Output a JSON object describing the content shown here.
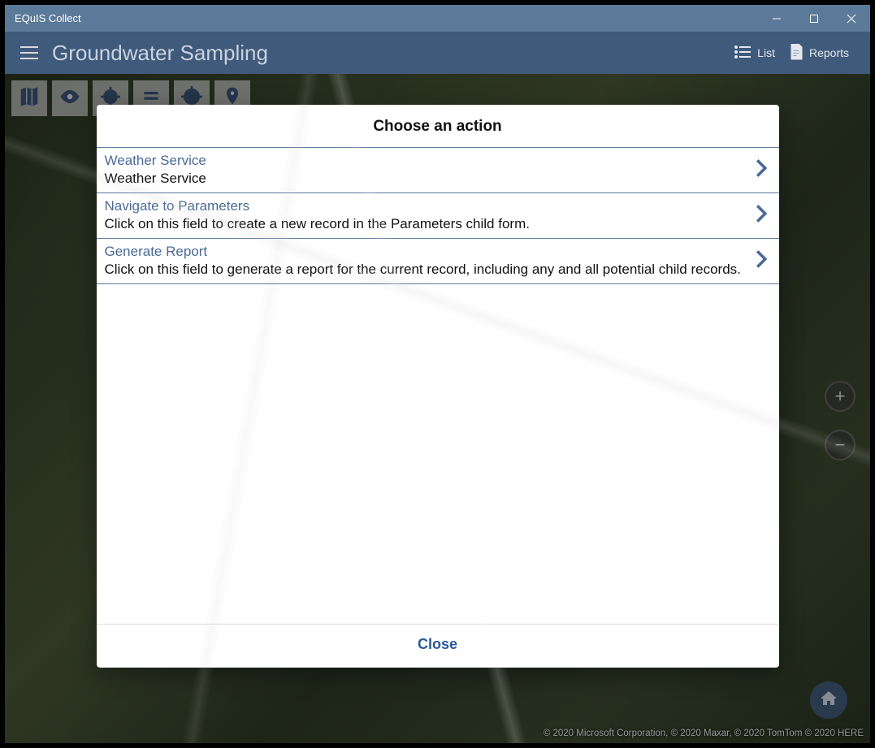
{
  "window": {
    "title": "EQuIS Collect"
  },
  "header": {
    "page_title": "Groundwater Sampling",
    "list_label": "List",
    "reports_label": "Reports"
  },
  "map": {
    "attribution": "© 2020 Microsoft Corporation, © 2020 Maxar, © 2020 TomTom © 2020 HERE"
  },
  "dialog": {
    "title": "Choose an action",
    "close_label": "Close",
    "actions": [
      {
        "title": "Weather Service",
        "desc": "Weather Service"
      },
      {
        "title": "Navigate to Parameters",
        "desc": "Click on this field to create a new record in the Parameters child form."
      },
      {
        "title": "Generate Report",
        "desc": "Click on this field to generate a report for the current record, including any and all potential child records."
      }
    ]
  }
}
